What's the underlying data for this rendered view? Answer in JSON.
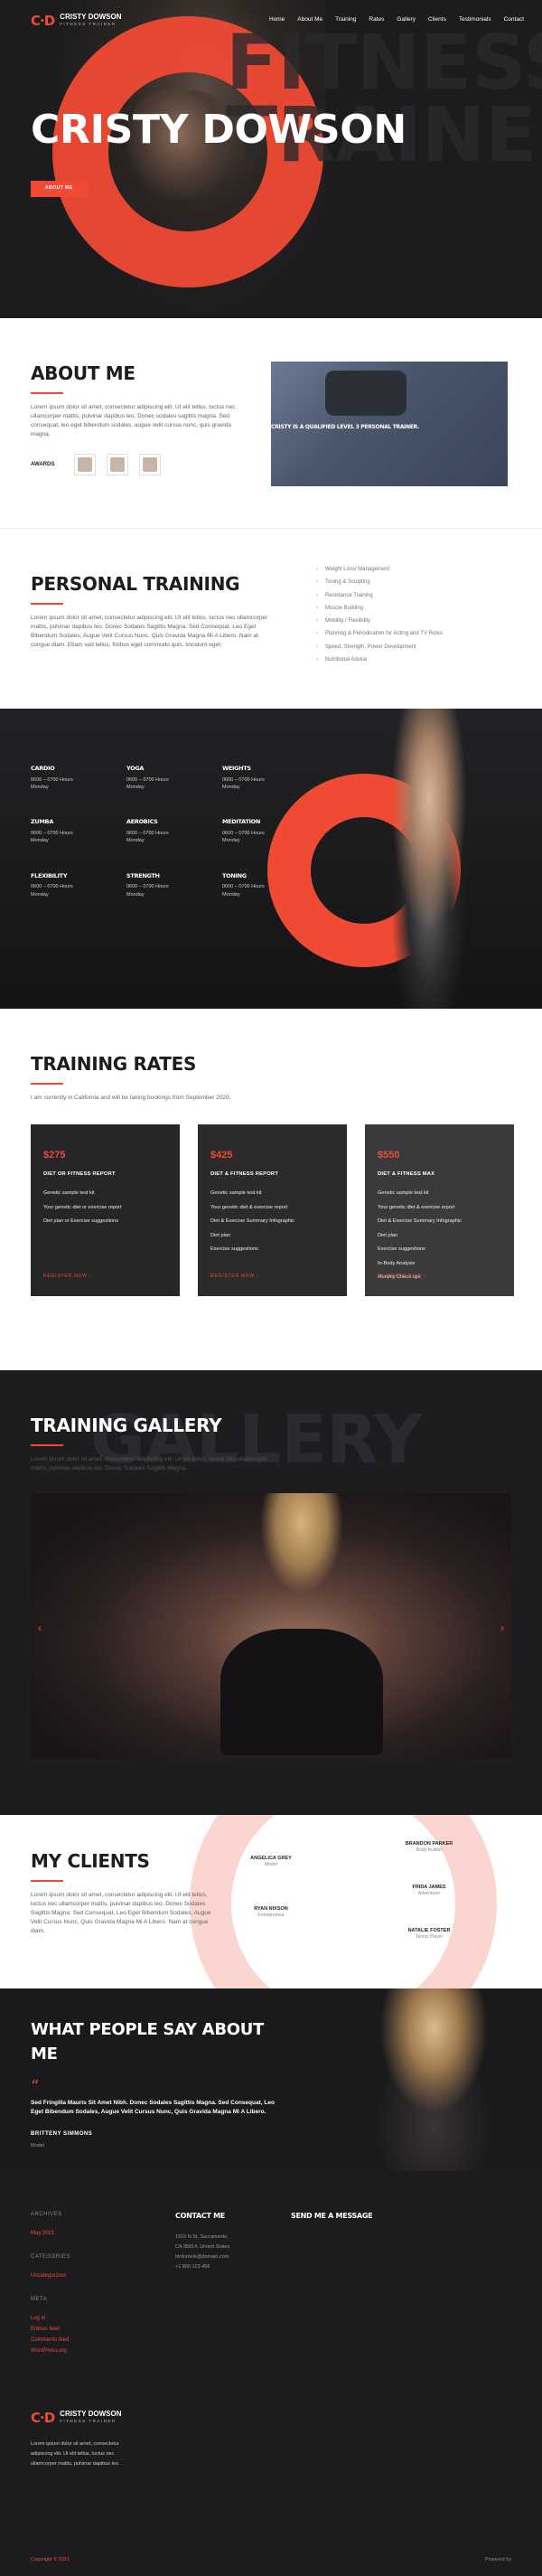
{
  "brand": {
    "mark": "C·D",
    "name": "CRISTY DOWSON",
    "sub": "FITNESS TRAINER"
  },
  "nav": [
    "Home",
    "About Me",
    "Training",
    "Rates",
    "Gallery",
    "Clients",
    "Testimonials",
    "Contact"
  ],
  "hero": {
    "title": "CRISTY DOWSON",
    "button": "ABOUT ME",
    "bg_text": "FITNESS TRAINER"
  },
  "about": {
    "title": "ABOUT ME",
    "text": "Lorem ipsum dolor sit amet, consectetur adipiscing elit. Ut elit tellus, luctus nec ullamcorper mattis, pulvinar dapibus leo. Donec sodales sagittis magna. Sed consequat, leo eget bibendum sodales, augue velit cursus nunc, quis gravida magna.",
    "awards_label": "AWARDS",
    "caption": "CRISTY IS A QUALIFIED LEVEL 3 PERSONAL TRAINER."
  },
  "training": {
    "title": "PERSONAL TRAINING",
    "text": "Lorem ipsum dolor sit amet, consectetur adipiscing elit. Ut elit tellus, luctus nec ullamcorper mattis, pulvinar dapibus leo. Donec Sodales Sagittis Magna. Sed Consequat, Leo Eget Bibendum Sodales, Augue Velit Cursus Nunc, Quis Gravida Magna Mi A Libero. Nam at congue diam. Etiam sed tellus, finibus eget commodo quis, tincidunt eget.",
    "list": [
      "Weight Loss/ Management",
      "Toning & Sculpting",
      "Resistance Training",
      "Muscle Building",
      "Mobility / Flexibility",
      "Planning & Periodisation for Acting and TV Roles",
      "Speed, Strength, Power Development",
      "Nutritional Advice"
    ]
  },
  "schedule": [
    {
      "t": "CARDIO",
      "h": "0600 – 0700 Hours",
      "d": "Monday"
    },
    {
      "t": "YOGA",
      "h": "0600 – 0700 Hours",
      "d": "Monday"
    },
    {
      "t": "WEIGHTS",
      "h": "0600 – 0700 Hours",
      "d": "Monday"
    },
    {
      "t": "ZUMBA",
      "h": "0600 – 0700 Hours",
      "d": "Monday"
    },
    {
      "t": "AEROBICS",
      "h": "0600 – 0700 Hours",
      "d": "Monday"
    },
    {
      "t": "MEDITATION",
      "h": "0600 – 0700 Hours",
      "d": "Monday"
    },
    {
      "t": "FLEXIBILITY",
      "h": "0600 – 0700 Hours",
      "d": "Monday"
    },
    {
      "t": "STRENGTH",
      "h": "0600 – 0700 Hours",
      "d": "Monday"
    },
    {
      "t": "TONING",
      "h": "0600 – 0700 Hours",
      "d": "Monday"
    }
  ],
  "rates": {
    "title": "TRAINING RATES",
    "text": "I am currently in California and will be taking bookings from September 2020.",
    "cards": [
      {
        "price": "$275",
        "name": "DIET OR FITNESS REPORT",
        "items": [
          "Genetic sample test kit",
          "Your genetic diet or exercise report",
          "Diet plan or Exercise suggestions"
        ],
        "reg": "REGISTER NOW ›"
      },
      {
        "price": "$425",
        "name": "DIET & FITNESS REPORT",
        "items": [
          "Genetic sample test kit",
          "Your genetic diet & exercise report",
          "Diet & Exercise Summary Infographic",
          "Diet plan",
          "Exercise suggestions"
        ],
        "reg": "REGISTER NOW ›"
      },
      {
        "price": "$550",
        "name": "DIET & FITNESS MAX",
        "items": [
          "Genetic sample test kit",
          "Your genetic diet & exercise report",
          "Diet & Exercise Summary Infographic",
          "Diet plan",
          "Exercise suggestions",
          "In-Body Analysis",
          "Monthly Check ups"
        ],
        "reg": "REGISTER NOW ›"
      }
    ]
  },
  "gallery": {
    "title": "TRAINING GALLERY",
    "bg_text": "GALLERY",
    "text": "Lorem ipsum dolor sit amet, consectetur adipiscing elit. Ut elit tellus, luctus nec ullamcorper mattis, pulvinar dapibus leo. Donec Sodales Sagittis Magna.",
    "prev": "‹",
    "next": "›"
  },
  "clients": {
    "title": "MY CLIENTS",
    "text": "Lorem ipsum dolor sit amet, consectetur adipiscing elit. Ut elit tellus, luctus nec ullamcorper mattis, pulvinar dapibus leo. Donec Sodales Sagittis Magna. Sed Consequat, Leo Eget Bibendum Sodales, Augue Velit Cursus Nunc, Quis Gravida Magna Mi A Libero. Nam at congue diam.",
    "list": [
      {
        "n": "ANGELICA GREY",
        "r": "Model"
      },
      {
        "n": "BRANDON PARKER",
        "r": "Body Builder"
      },
      {
        "n": "RYAN NIXSON",
        "r": "Entrepreneur"
      },
      {
        "n": "FRIDA JAMES",
        "r": "Adventurer"
      },
      {
        "n": "NATALIE FOSTER",
        "r": "Tennis Player"
      }
    ]
  },
  "testimonial": {
    "title": "WHAT PEOPLE SAY ABOUT ME",
    "quote_mark": "“",
    "text": "Sed Fringilla Mauris Sit Amet Nibh. Donec Sodales Sagittis Magna. Sed Consequat, Leo Eget Bibendum Sodales, Augue Velit Cursus Nunc, Quis Gravida Magna Mi A Libero.",
    "name": "BRITTENY SIMMONS",
    "role": "Model"
  },
  "footer": {
    "archives_h": "ARCHIVES",
    "archives": [
      "May 2021"
    ],
    "cats_h": "CATEGORIES",
    "cats": [
      "Uncategorized"
    ],
    "meta_h": "META",
    "meta": [
      "Log in",
      "Entries feed",
      "Comments feed",
      "WordPress.org"
    ],
    "contact_h": "CONTACT ME",
    "contact": [
      "1915 N St, Sacramento,",
      "CA 95814, United States",
      "birdonlele@domain.com",
      "+1 800 123 456"
    ],
    "message_h": "SEND ME A MESSAGE",
    "about": "Lorem ipsum dolor sit amet, consectetur adipiscing elit. Ut elit tellus, luctus nec ullamcorper mattis, pulvinar dapibus leo.",
    "copyright": "Copyright © 2021",
    "powered": "Powered by"
  },
  "colors": {
    "accent": "#f04a35",
    "dark": "#1c1c1f",
    "ring_light": "#fbd6d0"
  }
}
